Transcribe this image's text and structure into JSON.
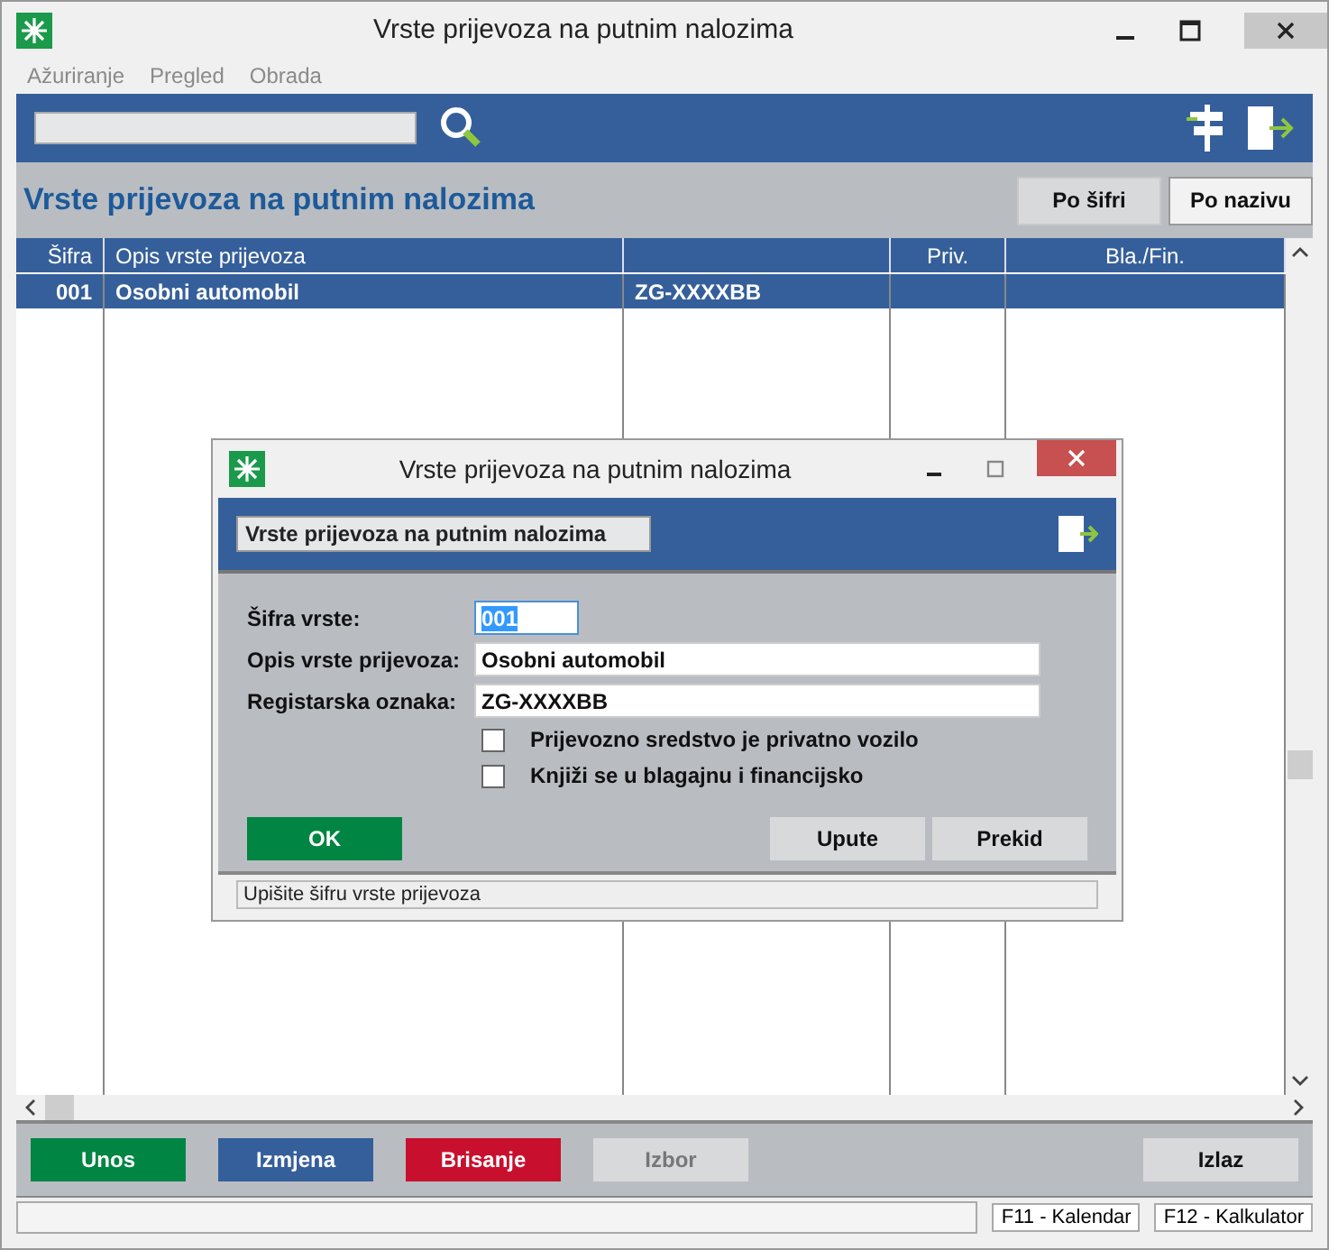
{
  "window": {
    "title": "Vrste prijevoza na putnim nalozima"
  },
  "menu": [
    {
      "label": "Ažuriranje",
      "disabled": true
    },
    {
      "label": "Pregled",
      "disabled": true
    },
    {
      "label": "Obrada",
      "disabled": true
    }
  ],
  "header": {
    "title": "Vrste prijevoza na putnim nalozima",
    "sort_buttons": [
      {
        "label": "Po šifri",
        "selected": false
      },
      {
        "label": "Po nazivu",
        "selected": true
      }
    ]
  },
  "table": {
    "columns": [
      {
        "label": "Šifra"
      },
      {
        "label": "Opis vrste prijevoza"
      },
      {},
      {
        "label": "Priv."
      },
      {
        "label": "Bla./Fin."
      }
    ],
    "rows": [
      {
        "selected": true,
        "cells": [
          "001",
          "Osobni automobil",
          "ZG-XXXXBB"
        ]
      }
    ]
  },
  "buttons": [
    {
      "label": "Unos",
      "kind": "add",
      "disabled": false
    },
    {
      "label": "Izmjena",
      "kind": "edit",
      "disabled": false
    },
    {
      "label": "Brisanje",
      "kind": "delete",
      "disabled": false
    },
    {
      "label": "Izbor",
      "kind": "plain",
      "disabled": true
    },
    {
      "label": "Izlaz",
      "kind": "exit",
      "disabled": false
    }
  ],
  "status_bar": [
    "F11 - Kalendar",
    "F12 - Kalkulator"
  ],
  "dialog": {
    "title": "Vrste prijevoza na putnim nalozima",
    "header_label": "Vrste prijevoza na putnim nalozima",
    "fields": [
      {
        "label": "Šifra vrste:",
        "value": "001",
        "focused": true
      },
      {
        "label": "Opis vrste prijevoza:",
        "value": "Osobni automobil",
        "focused": false
      },
      {
        "label": "Registarska oznaka:",
        "value": "ZG-XXXXBB",
        "focused": false
      }
    ],
    "checkboxes": [
      {
        "label": "Prijevozno sredstvo je privatno vozilo",
        "checked": false
      },
      {
        "label": "Knjiži se u blagajnu i financijsko",
        "checked": false
      }
    ],
    "ok": "OK",
    "buttons": [
      "Upute",
      "Prekid"
    ],
    "status": "Upišite šifru vrste prijevoza"
  }
}
